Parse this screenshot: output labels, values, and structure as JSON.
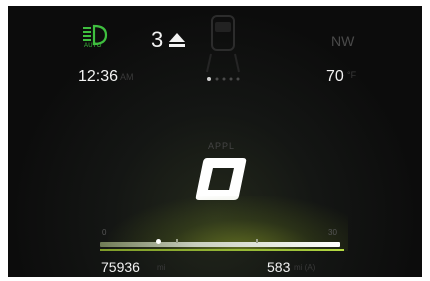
{
  "status_bar": {
    "headlight_icon": "auto-headlight-icon",
    "headlight_label": "AUTO",
    "headlight_color": "#3fbf3f",
    "gear_number": "3",
    "gear_indicator_icon": "shift-up-icon",
    "car_icon": "car-top-view-icon",
    "compass": "NW"
  },
  "info_row": {
    "clock": "12:36",
    "clock_unit": "AM",
    "temperature": "70",
    "temperature_unit": "°F"
  },
  "center": {
    "gear_mode_label": "APPL",
    "gear": "O"
  },
  "range_bar": {
    "min_label": "0",
    "max_label": "30",
    "accent": "#9fc33a"
  },
  "bottom": {
    "odometer": "75936",
    "odometer_unit": "mi",
    "trip": "583",
    "trip_unit": "mi (A)"
  }
}
